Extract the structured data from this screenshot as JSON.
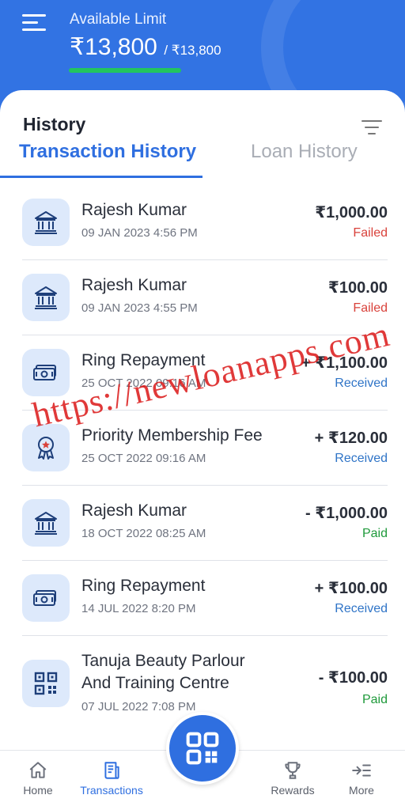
{
  "header": {
    "limit_label": "Available Limit",
    "limit_amount": "₹13,800",
    "limit_total": "/ ₹13,800",
    "limit_used_fraction": 1.0
  },
  "history": {
    "title": "History",
    "tabs": [
      {
        "label": "Transaction History",
        "active": true
      },
      {
        "label": "Loan History",
        "active": false
      }
    ]
  },
  "transactions": [
    {
      "icon": "bank-icon",
      "name": "Rajesh Kumar",
      "time": "09 JAN 2023 4:56 PM",
      "amount": "₹1,000.00",
      "status": "Failed"
    },
    {
      "icon": "bank-icon",
      "name": "Rajesh Kumar",
      "time": "09 JAN 2023 4:55 PM",
      "amount": "₹100.00",
      "status": "Failed"
    },
    {
      "icon": "cash-icon",
      "name": "Ring Repayment",
      "time": "25 OCT 2022 09:16 AM",
      "amount": "+ ₹1,100.00",
      "status": "Received"
    },
    {
      "icon": "badge-icon",
      "name": "Priority Membership Fee",
      "time": "25 OCT 2022 09:16 AM",
      "amount": "+ ₹120.00",
      "status": "Received"
    },
    {
      "icon": "bank-icon",
      "name": "Rajesh Kumar",
      "time": "18 OCT 2022 08:25 AM",
      "amount": "- ₹1,000.00",
      "status": "Paid"
    },
    {
      "icon": "cash-icon",
      "name": "Ring Repayment",
      "time": "14 JUL 2022 8:20 PM",
      "amount": "+ ₹100.00",
      "status": "Received"
    },
    {
      "icon": "qr-icon",
      "name": "Tanuja Beauty Parlour And Training Centre",
      "time": "07 JUL 2022 7:08 PM",
      "amount": "- ₹100.00",
      "status": "Paid"
    }
  ],
  "status_colors": {
    "Failed": "#d9423b",
    "Received": "#2f74c7",
    "Paid": "#1f9a3b"
  },
  "watermark": "https://newloanapps.com",
  "nav": [
    {
      "icon": "home-icon",
      "label": "Home"
    },
    {
      "icon": "receipt-icon",
      "label": "Transactions"
    },
    {
      "icon": "qr-scan-icon",
      "label": ""
    },
    {
      "icon": "trophy-icon",
      "label": "Rewards"
    },
    {
      "icon": "more-icon",
      "label": "More"
    }
  ]
}
